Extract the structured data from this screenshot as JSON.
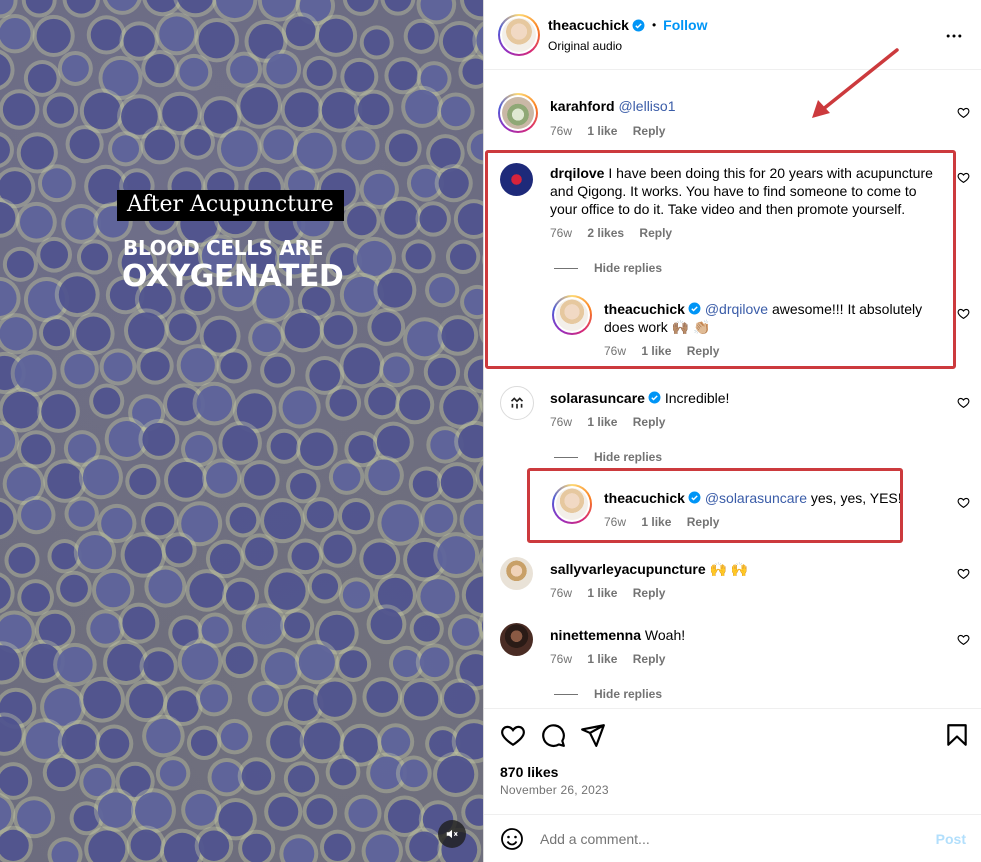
{
  "media": {
    "label": "After Acupuncture",
    "headline_line1": "BLOOD CELLS ARE",
    "headline_line2": "OXYGENATED",
    "mute_icon": "speaker-muted-icon"
  },
  "header": {
    "username": "theacuchick",
    "verified": true,
    "separator": "•",
    "follow_label": "Follow",
    "audio": "Original audio",
    "more_icon": "more-horizontal-icon"
  },
  "comments": [
    {
      "username": "karahford",
      "mention": "@lelliso1",
      "text": "",
      "time": "76w",
      "likes": "1 like",
      "reply": "Reply"
    },
    {
      "username": "drqilove",
      "text": "I have been doing this for 20 years with acupuncture and Qigong. It works. You have to find someone to come to your office to do it. Take video and then promote yourself.",
      "time": "76w",
      "likes": "2 likes",
      "reply": "Reply",
      "hide_replies": "Hide replies",
      "replies": [
        {
          "username": "theacuchick",
          "verified": true,
          "mention": "@drqilove",
          "text": " awesome!!! It absolutely does work 🙌🏽 👏🏼",
          "time": "76w",
          "likes": "1 like",
          "reply": "Reply"
        }
      ]
    },
    {
      "username": "solarasuncare",
      "verified": true,
      "text": "Incredible!",
      "time": "76w",
      "likes": "1 like",
      "reply": "Reply",
      "hide_replies": "Hide replies",
      "replies": [
        {
          "username": "theacuchick",
          "verified": true,
          "mention": "@solarasuncare",
          "text": " yes, yes, YES!",
          "time": "76w",
          "likes": "1 like",
          "reply": "Reply"
        }
      ]
    },
    {
      "username": "sallyvarleyacupuncture",
      "text": "🙌 🙌",
      "time": "76w",
      "likes": "1 like",
      "reply": "Reply"
    },
    {
      "username": "ninettemenna",
      "text": "Woah!",
      "time": "76w",
      "likes": "1 like",
      "reply": "Reply",
      "hide_replies": "Hide replies"
    }
  ],
  "actions": {
    "like_icon": "heart-icon",
    "comment_icon": "comment-bubble-icon",
    "share_icon": "paper-plane-icon",
    "save_icon": "bookmark-icon",
    "likes_total": "870 likes",
    "date": "November 26, 2023"
  },
  "add_comment": {
    "emoji_icon": "smiley-icon",
    "placeholder": "Add a comment...",
    "post_label": "Post"
  },
  "colors": {
    "link": "#0095f6",
    "mention": "#3a5ca8",
    "annotation_red": "#cc3a3d",
    "muted_text": "#737373"
  }
}
